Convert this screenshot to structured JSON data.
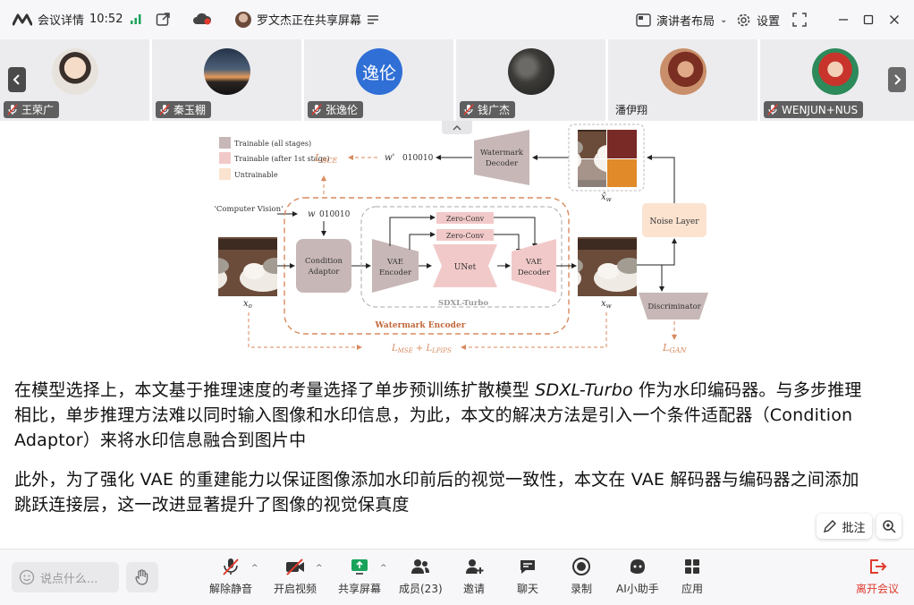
{
  "titlebar": {
    "meeting_details": "会议详情",
    "time": "10:52",
    "sharing_status": "罗文杰正在共享屏幕",
    "layout": "演讲者布局",
    "settings": "设置"
  },
  "participants": [
    {
      "name": "王荣广",
      "muted": true
    },
    {
      "name": "秦玉棚",
      "muted": true
    },
    {
      "name": "张逸伦",
      "muted": true,
      "avatar_text": "逸伦"
    },
    {
      "name": "钱广杰",
      "muted": true
    },
    {
      "name": "潘伊翔",
      "muted": false
    },
    {
      "name": "WENJUN+NUS",
      "muted": true
    }
  ],
  "figure": {
    "legend": [
      "Trainable (all stages)",
      "Trainable (after 1st stage)",
      "Untrainable"
    ],
    "input_text": "'Computer Vision'",
    "w_label": "w",
    "w_bits": "010010",
    "w_prime_label": "w'",
    "w_prime_bits": "010010",
    "loss_bce": "L",
    "loss_bce_sub": "BCE",
    "loss_mse": "L",
    "loss_mse_sub": "MSE",
    "loss_lpips_sub": "LPIPS",
    "loss_gan": "L",
    "loss_gan_sub": "GAN",
    "condition_adaptor": [
      "Condition",
      "Adaptor"
    ],
    "vae_encoder": [
      "VAE",
      "Encoder"
    ],
    "zero_conv_1": "Zero-Conv",
    "zero_conv_2": "Zero-Conv",
    "unet": "UNet",
    "vae_decoder": [
      "VAE",
      "Decoder"
    ],
    "sdxl_turbo": "SDXL-Turbo",
    "watermark_encoder": "Watermark Encoder",
    "watermark_decoder": [
      "Watermark",
      "Decoder"
    ],
    "noise_layer": "Noise Layer",
    "discriminator": "Discriminator",
    "x_o": "x",
    "x_o_sub": "o",
    "x_w": "x",
    "x_w_sub": "w",
    "x_hat_w": "x̂",
    "x_hat_w_sub": "w"
  },
  "content": {
    "para1_line1_a": "在模型选择上，本文基于推理速度的考量选择了单步预训练扩散模型 ",
    "para1_line1_em": "SDXL-Turbo",
    "para1_line1_b": " 作为水印编码器。与多步推理",
    "para1_line2": "相比，单步推理方法难以同时输入图像和水印信息，为此，本文的解决方法是引入一个条件适配器（Condition",
    "para1_line3": "Adaptor）来将水印信息融合到图片中",
    "para2_line1": "此外，为了强化 VAE 的重建能力以保证图像添加水印前后的视觉一致性，本文在 VAE 解码器与编码器之间添加",
    "para2_line2": "跳跃连接层，这一改进显著提升了图像的视觉保真度"
  },
  "annotate_button": "批注",
  "chat_input": {
    "placeholder": "说点什么..."
  },
  "toolbar": {
    "unmute": "解除静音",
    "start_video": "开启视频",
    "share_screen": "共享屏幕",
    "members": "成员(23)",
    "invite": "邀请",
    "chat": "聊天",
    "record": "录制",
    "ai_assistant": "AI小助手",
    "apps": "应用",
    "leave": "离开会议"
  },
  "colors": {
    "leave": "#e03b2f",
    "share_green": "#1aa35b",
    "trainable_all": "#c8b7b7",
    "trainable_after": "#f2c9c9",
    "untrainable": "#fbe3d0",
    "dashed_orange": "#d98a5e"
  }
}
